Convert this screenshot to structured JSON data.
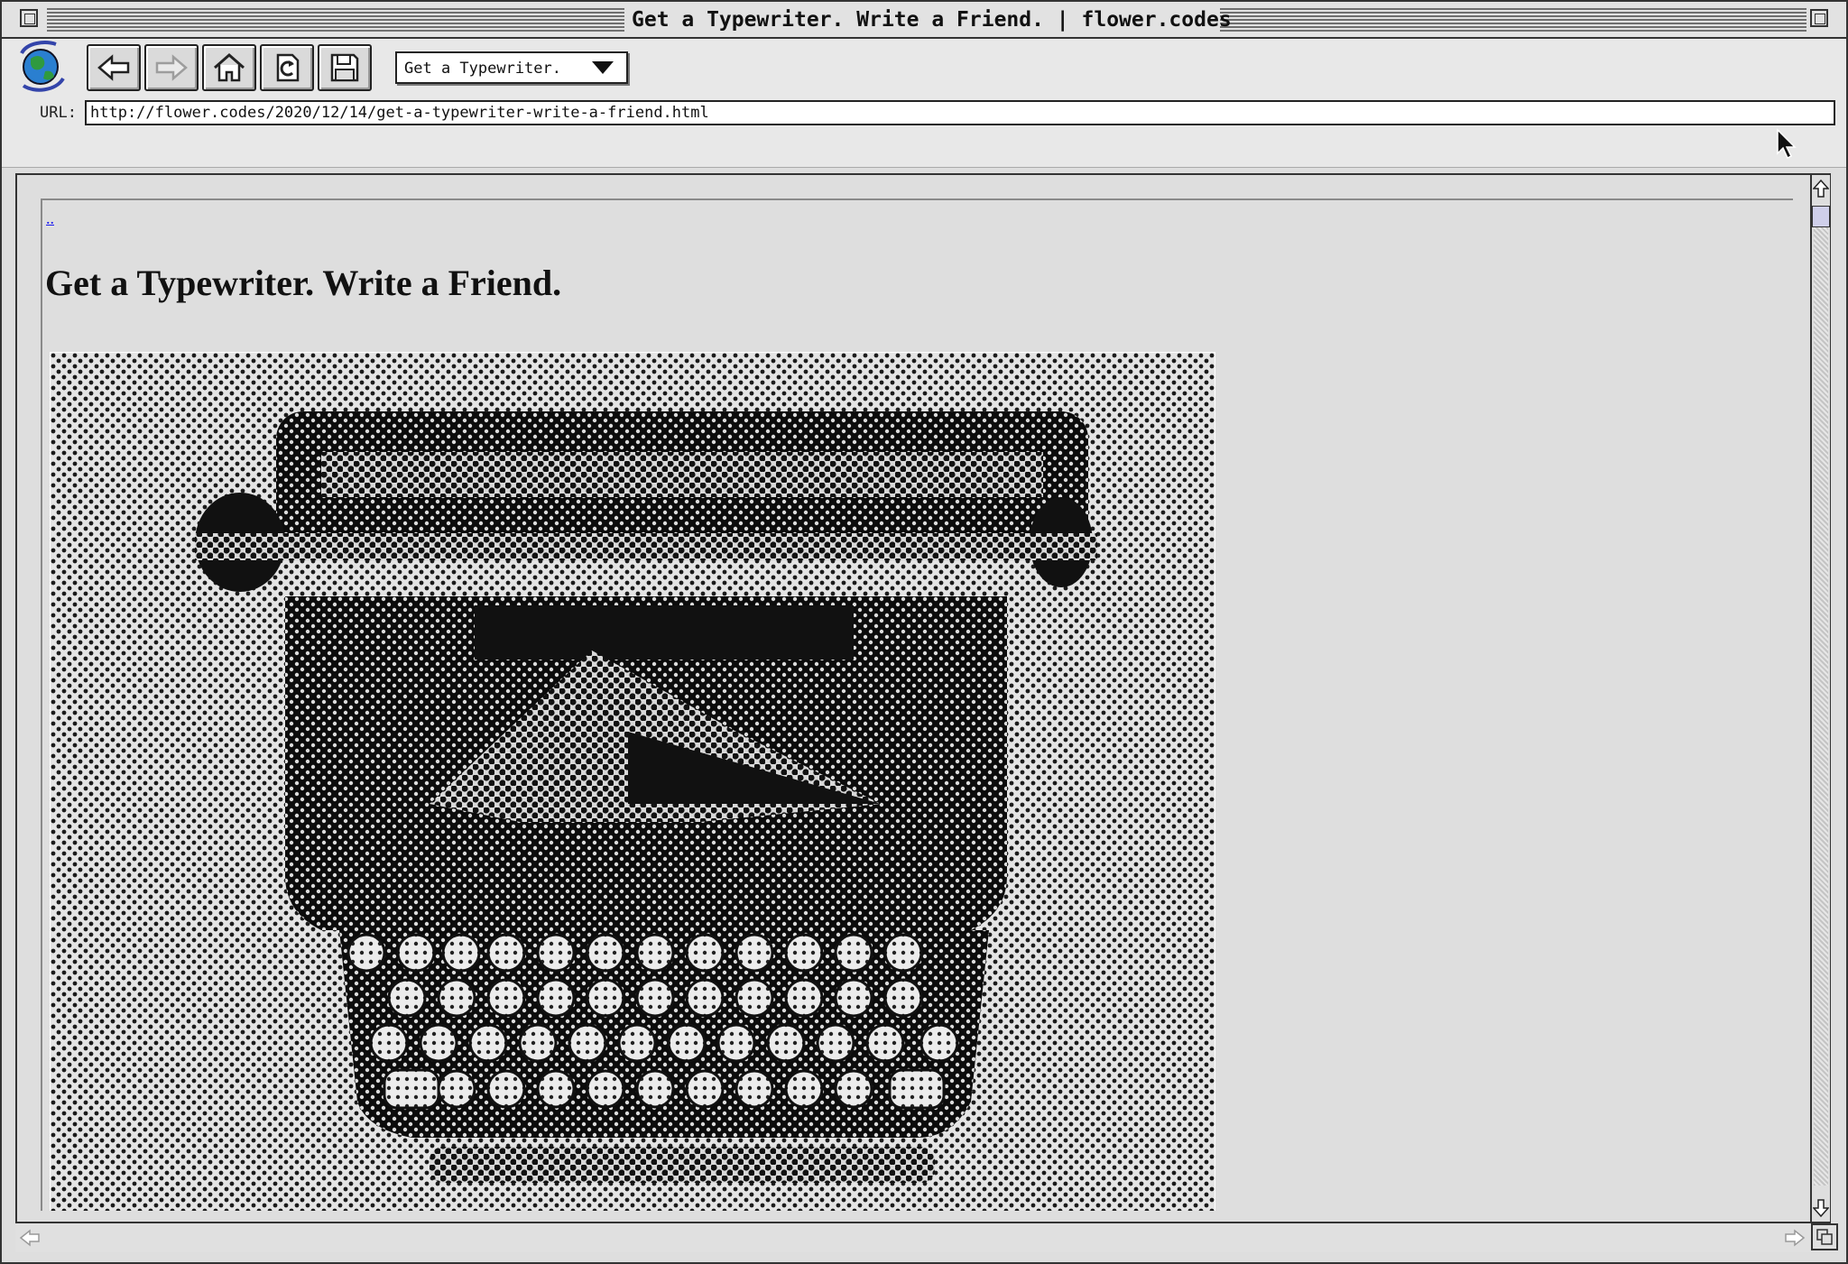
{
  "window": {
    "title": "Get a Typewriter. Write a Friend. | flower.codes"
  },
  "toolbar": {
    "buttons": [
      {
        "name": "back",
        "icon": "back-arrow-icon"
      },
      {
        "name": "forward",
        "icon": "forward-arrow-icon"
      },
      {
        "name": "home",
        "icon": "home-icon"
      },
      {
        "name": "reload",
        "icon": "reload-icon"
      },
      {
        "name": "save",
        "icon": "save-disk-icon"
      }
    ],
    "history_dropdown_value": "Get a Typewriter."
  },
  "url_bar": {
    "label": "URL:",
    "value": "http://flower.codes/2020/12/14/get-a-typewriter-write-a-friend.html"
  },
  "page": {
    "back_link": "..",
    "heading": "Get a Typewriter. Write a Friend.",
    "image_alt": "dithered halftone photo of a vintage typewriter"
  },
  "colors": {
    "link": "#1a1aee",
    "background": "#dedede"
  }
}
